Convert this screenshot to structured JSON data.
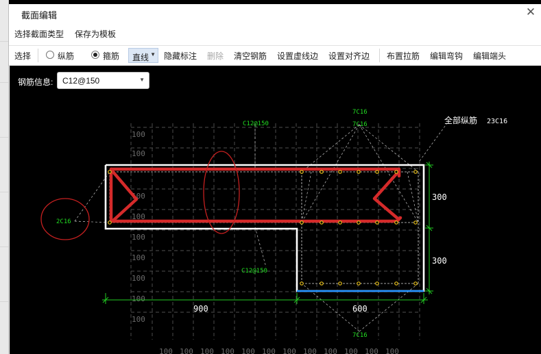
{
  "window": {
    "title": "截面编辑",
    "close_symbol": "✕"
  },
  "menu": {
    "items": [
      "选择截面类型",
      "保存为模板"
    ]
  },
  "toolbar": {
    "select": "选择",
    "longitudinal": "纵筋",
    "stirrup": "箍筋",
    "line_mode": "直线",
    "hide_dims": "隐藏标注",
    "delete": "删除",
    "clear": "清空钢筋",
    "set_virtual": "设置虚线边",
    "set_align": "设置对齐边",
    "place_tie": "布置拉筋",
    "edit_hook": "编辑弯钩",
    "edit_end": "编辑端头",
    "selected_radio": "stirrup"
  },
  "panel": {
    "label": "钢筋信息:",
    "value": "C12@150"
  },
  "drawing": {
    "grid_label": "100",
    "ann_top1": "7C16",
    "ann_top2": "7C16",
    "ann_stir_top": "C12@150",
    "ann_stir_bottom": "C12@150",
    "ann_left": "2C16",
    "ann_bottom": "7C16",
    "all_long_label": "全部纵筋",
    "all_long_value": "23C16",
    "dim_right_top": "300",
    "dim_right_bottom": "300",
    "dim_bottom_left": "900",
    "dim_bottom_right": "600",
    "colors": {
      "stirrup": "#d42a2a",
      "outline": "#ffffff",
      "dim": "#22cc22",
      "rebar": "#e8c01a",
      "grid": "#6b6b6b",
      "edge": "#1e90ff"
    }
  }
}
